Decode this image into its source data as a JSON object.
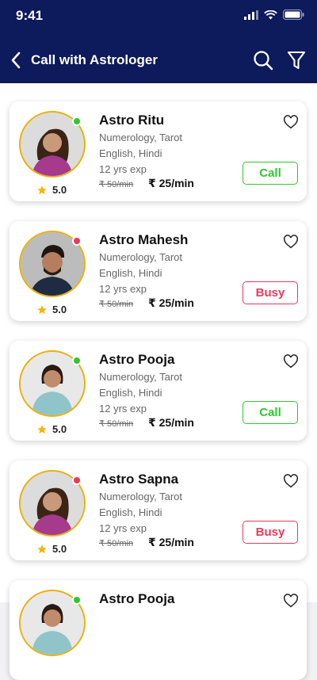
{
  "status_bar": {
    "time": "9:41",
    "icons": [
      "signal-icon",
      "wifi-icon",
      "battery-icon"
    ]
  },
  "header": {
    "title": "Call with Astrologer",
    "back_icon": "back-arrow-icon",
    "search_icon": "search-icon",
    "filter_icon": "filter-icon"
  },
  "colors": {
    "header_bg": "#0d1a5c",
    "online": "#2fc72f",
    "busy": "#e83a5b",
    "star": "#f5b50a",
    "avatar_ring": "#e9b10d"
  },
  "astrologers": [
    {
      "name": "Astro Ritu",
      "skills": "Numerology, Tarot",
      "languages": "English, Hindi",
      "experience": "12 yrs exp",
      "old_price": "₹ 50/min",
      "price": "₹ 25/min",
      "rating": "5.0",
      "status": "online",
      "action": "Call"
    },
    {
      "name": "Astro Mahesh",
      "skills": "Numerology, Tarot",
      "languages": "English, Hindi",
      "experience": "12 yrs exp",
      "old_price": "₹ 50/min",
      "price": "₹ 25/min",
      "rating": "5.0",
      "status": "busy",
      "action": "Busy"
    },
    {
      "name": "Astro Pooja",
      "skills": "Numerology, Tarot",
      "languages": "English, Hindi",
      "experience": "12 yrs exp",
      "old_price": "₹ 50/min",
      "price": "₹ 25/min",
      "rating": "5.0",
      "status": "online",
      "action": "Call"
    },
    {
      "name": "Astro Sapna",
      "skills": "Numerology, Tarot",
      "languages": "English, Hindi",
      "experience": "12 yrs exp",
      "old_price": "₹ 50/min",
      "price": "₹ 25/min",
      "rating": "5.0",
      "status": "busy",
      "action": "Busy"
    },
    {
      "name": "Astro Pooja",
      "status": "online"
    }
  ]
}
